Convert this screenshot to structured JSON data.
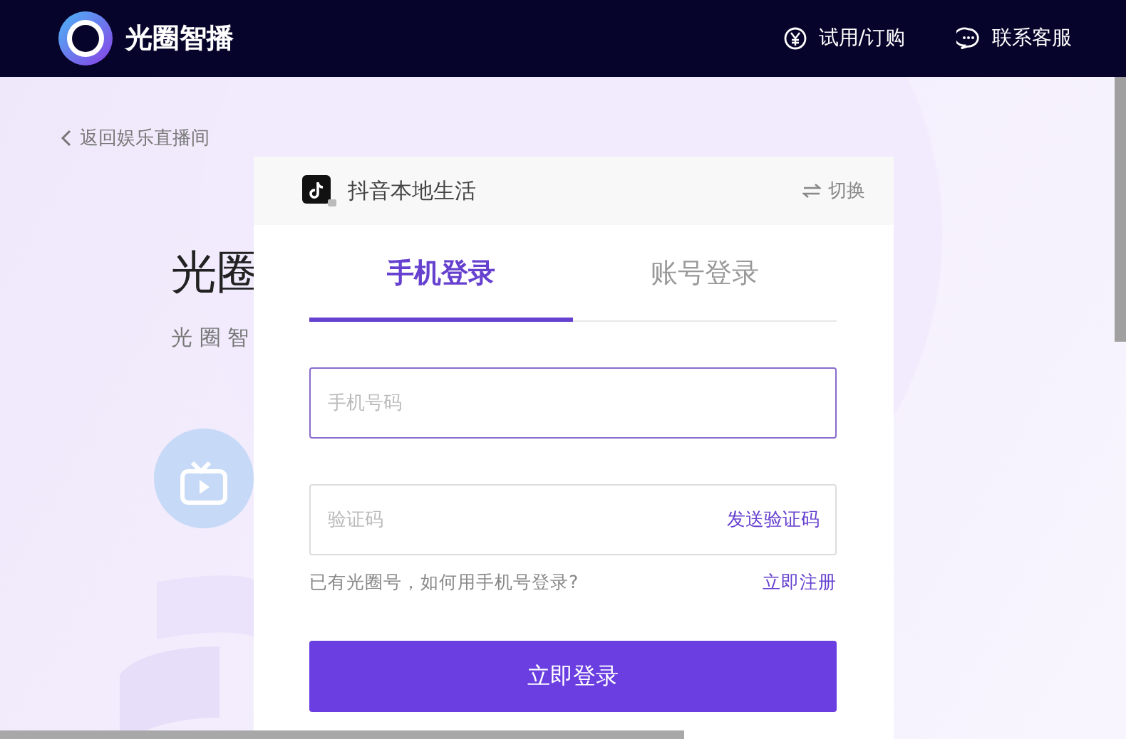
{
  "header": {
    "brand": "光圈智播",
    "actions": [
      {
        "kind": "price",
        "label": "试用/订购"
      },
      {
        "kind": "chat",
        "label": "联系客服"
      }
    ]
  },
  "back_link": "返回娱乐直播间",
  "hero": {
    "title": "光圈",
    "subtitle": "光 圈 智"
  },
  "card": {
    "platform": "抖音本地生活",
    "switch": "切换",
    "tabs": [
      {
        "label": "手机登录",
        "selected": true
      },
      {
        "label": "账号登录",
        "selected": false
      }
    ],
    "phone_field": {
      "placeholder": "手机号码"
    },
    "code_field": {
      "placeholder": "验证码",
      "action": "发送验证码"
    },
    "hint": "已有光圈号，如何用手机号登录?",
    "register_link": "立即注册",
    "submit": "立即登录"
  }
}
